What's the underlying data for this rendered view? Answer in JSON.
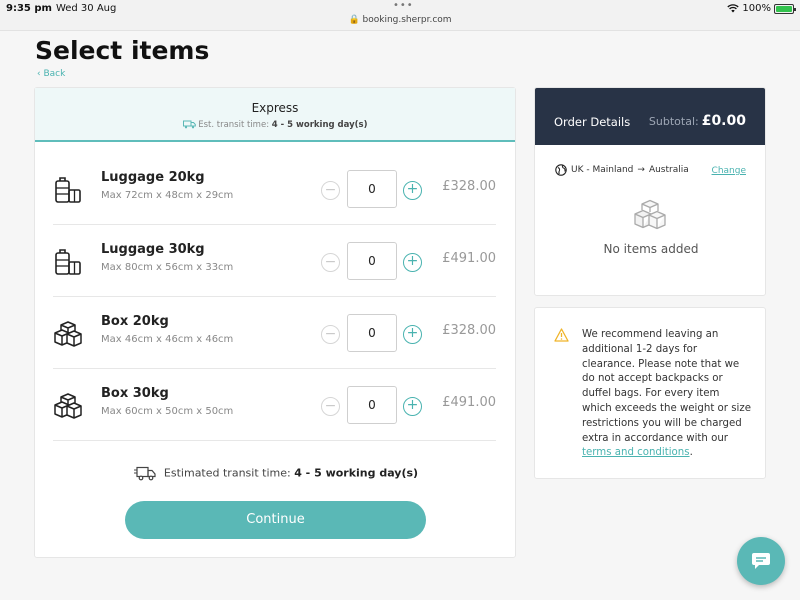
{
  "status_bar": {
    "time": "9:35 pm",
    "date": "Wed 30 Aug",
    "url": "booking.sherpr.com",
    "battery": "100%",
    "battery_level": 1.0
  },
  "page": {
    "title": "Select items",
    "back_label": "Back"
  },
  "service": {
    "name": "Express",
    "transit_prefix": "Est. transit time:",
    "transit_value": "4 - 5 working day(s)"
  },
  "items": [
    {
      "name": "Luggage 20kg",
      "dims": "Max 72cm x 48cm x 29cm",
      "qty": "0",
      "price": "£328.00",
      "icon": "luggage-icon"
    },
    {
      "name": "Luggage 30kg",
      "dims": "Max 80cm x 56cm x 33cm",
      "qty": "0",
      "price": "£491.00",
      "icon": "luggage-icon"
    },
    {
      "name": "Box 20kg",
      "dims": "Max 46cm x 46cm x 46cm",
      "qty": "0",
      "price": "£328.00",
      "icon": "box-icon"
    },
    {
      "name": "Box 30kg",
      "dims": "Max 60cm x 50cm x 50cm",
      "qty": "0",
      "price": "£491.00",
      "icon": "box-icon"
    }
  ],
  "footer": {
    "transit_prefix": "Estimated transit time:",
    "transit_value": "4 - 5 working day(s)",
    "continue_label": "Continue"
  },
  "order": {
    "title": "Order Details",
    "subtotal_label": "Subtotal:",
    "subtotal_value": "£0.00",
    "from": "UK - Mainland",
    "to": "Australia",
    "change_label": "Change",
    "empty_label": "No items added"
  },
  "notice": {
    "text": "We recommend leaving an additional 1-2 days for clearance. Please note that we do not accept backpacks or duffel bags. For every item which exceeds the weight or size restrictions you will be charged extra in accordance with our ",
    "link_text": "terms and conditions",
    "suffix": "."
  },
  "colors": {
    "accent": "#5ab8b6",
    "order_header": "#283346",
    "warning": "#f0b429"
  }
}
